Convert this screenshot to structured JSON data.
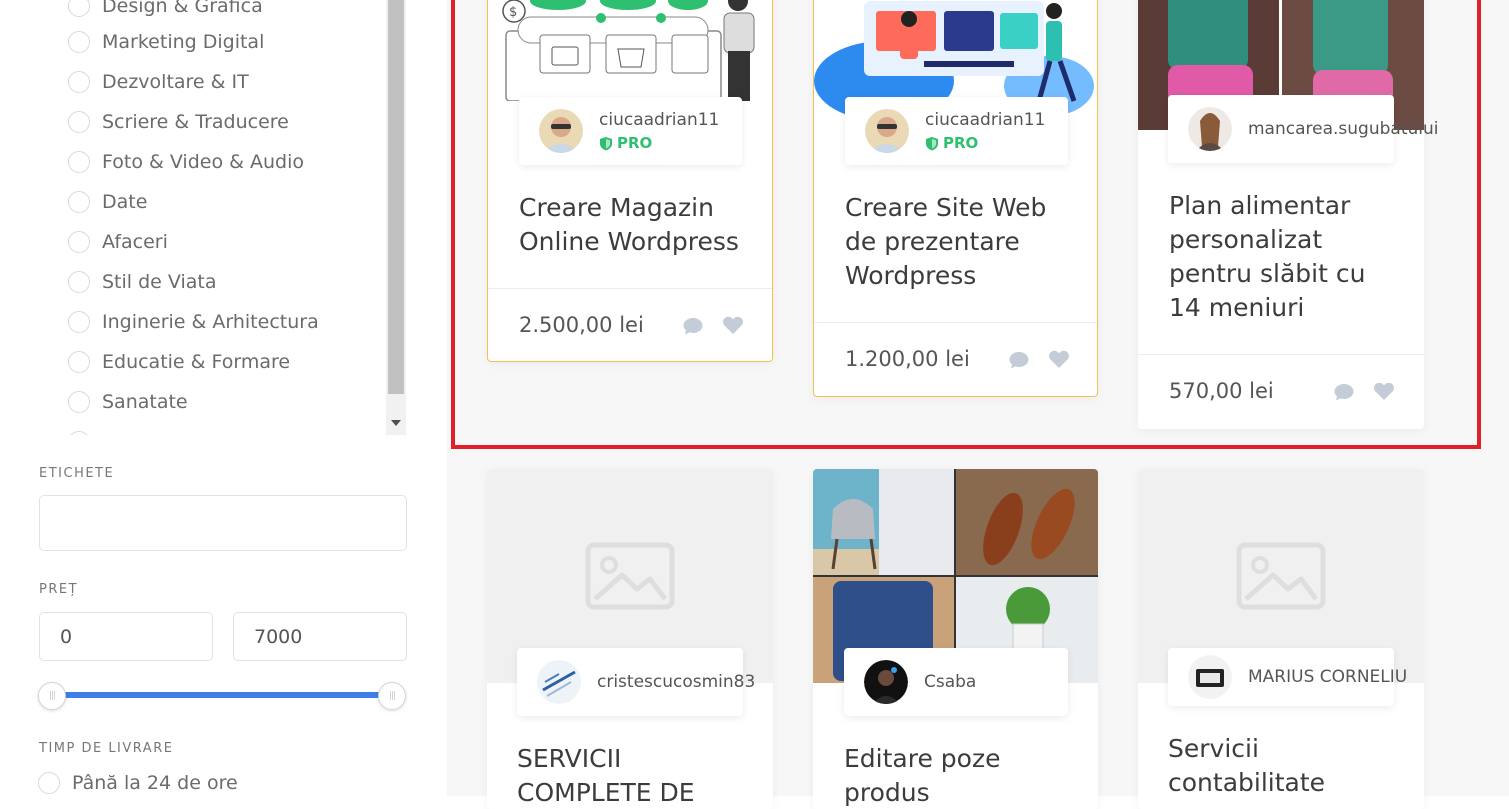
{
  "sidebar": {
    "categories": [
      "Design & Grafica",
      "Marketing Digital",
      "Dezvoltare & IT",
      "Scriere & Traducere",
      "Foto & Video & Audio",
      "Date",
      "Afaceri",
      "Stil de Viata",
      "Inginerie & Arhitectura",
      "Educatie & Formare",
      "Sanatate"
    ],
    "tags_title": "ETICHETE",
    "tags_value": "",
    "price_title": "PREȚ",
    "price_min": "0",
    "price_max": "7000",
    "price_range": {
      "min": 0,
      "max": 7000
    },
    "delivery_title": "TIMP DE LIVRARE",
    "delivery_first_option": "Până la 24 de ore"
  },
  "cards": [
    {
      "author": "ciucaadrian11",
      "badge": "PRO",
      "title": "Creare Magazin Online Wordpress",
      "price": "2.500,00 lei",
      "image": "online-shop-illustration"
    },
    {
      "author": "ciucaadrian11",
      "badge": "PRO",
      "title": "Creare Site Web de prezentare Wordpress",
      "price": "1.200,00 lei",
      "image": "web-team-illustration"
    },
    {
      "author": "mancarea.sugubatului",
      "badge": "",
      "title": "Plan alimentar personalizat pentru slăbit cu 14 meniuri",
      "price": "570,00 lei",
      "image": "before-after-photo"
    },
    {
      "author": "cristescucosmin83",
      "title": "SERVICII COMPLETE DE",
      "image": "placeholder-image"
    },
    {
      "author": "Csaba",
      "title": "Editare poze produs",
      "image": "product-photo-collage"
    },
    {
      "author": "MARIUS CORNELIU",
      "title": "Servicii contabilitate",
      "image": "placeholder-image"
    }
  ],
  "colors": {
    "accent_blue": "#3f7ee8",
    "pro_green": "#2fbf71",
    "pro_border": "#f0c24b",
    "highlight_red": "#e0202a",
    "icon_grey": "#c4ccd8"
  }
}
